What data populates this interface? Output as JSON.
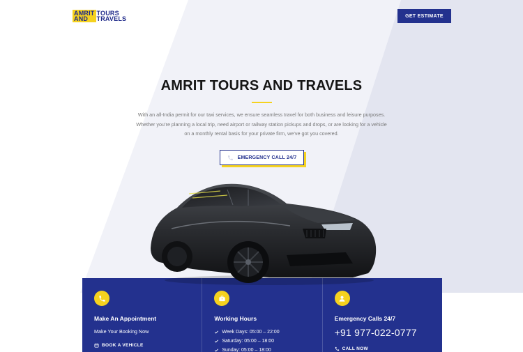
{
  "header": {
    "logo": {
      "line1_left": "AMRIT",
      "line2_left": "AND",
      "line1_right": "TOURS",
      "line2_right": "TRAVELS"
    },
    "cta_label": "GET ESTIMATE"
  },
  "hero": {
    "title": "AMRIT TOURS AND TRAVELS",
    "description_lines": [
      "With an all-India permit for our taxi services, we ensure seamless travel for both business and leisure purposes.",
      "Whether you’re planning a local trip, need airport or railway station pickups and drops, or are looking for a vehicle",
      "on a monthly rental basis for your private firm, we’ve got you covered."
    ],
    "button_label": "EMERGENCY CALL 24/7"
  },
  "info": {
    "appointment": {
      "title": "Make An Appointment",
      "subtitle": "Make Your Booking Now",
      "link": "BOOK A VEHICLE"
    },
    "hours": {
      "title": "Working Hours",
      "items": [
        "Week Days: 05:00 – 22:00",
        "Saturday: 05:00 – 18:00",
        "Sunday: 05:00 – 18:00"
      ]
    },
    "emergency": {
      "title": "Emergency Calls 24/7",
      "phone": "+91 977-022-0777",
      "link": "CALL NOW"
    }
  },
  "colors": {
    "brand_navy": "#23318e",
    "accent_yellow": "#f5d21f",
    "panel_bg": "#eceef6"
  },
  "icons": [
    "phone-icon",
    "briefcase-icon",
    "user-icon",
    "calendar-icon",
    "check-icon",
    "phone-small-icon"
  ]
}
